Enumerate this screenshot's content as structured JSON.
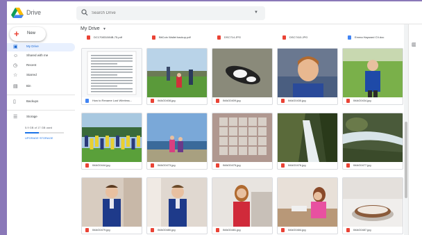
{
  "app": {
    "title": "Drive"
  },
  "search": {
    "placeholder": "Search Drive"
  },
  "new_button": {
    "label": "New"
  },
  "sidebar": {
    "items": [
      {
        "label": "My Drive",
        "icon": "my-drive-icon"
      },
      {
        "label": "Shared with me",
        "icon": "shared-icon"
      },
      {
        "label": "Recent",
        "icon": "clock-icon"
      },
      {
        "label": "Starred",
        "icon": "star-icon"
      },
      {
        "label": "Bin",
        "icon": "trash-icon"
      },
      {
        "label": "Backups",
        "icon": "backup-icon"
      },
      {
        "label": "Storage",
        "icon": "storage-icon"
      }
    ],
    "storage_used": "5.9 GB of 17 GB used",
    "storage_fraction": 0.35,
    "upgrade_label": "UPGRADE STORAGE"
  },
  "main": {
    "breadcrumb": "My Drive",
    "top_row": [
      {
        "name": "DC170831084B-75.pdf",
        "type": "pdf"
      },
      {
        "name": "BitCoin Wallet backup.pdf",
        "type": "pdf"
      },
      {
        "name": "DSC714.JPG",
        "type": "image"
      },
      {
        "name": "DSC7410.JPG",
        "type": "image"
      },
      {
        "name": "Emma Hayward CV.doc",
        "type": "doc"
      }
    ],
    "tiles": [
      {
        "name": "How to Rename Lost Wireless...",
        "type": "doc",
        "thumb": "document"
      },
      {
        "name": "IMAG0408.jpg",
        "type": "image",
        "thumb": "football-field"
      },
      {
        "name": "IMAG0409.jpg",
        "type": "image",
        "thumb": "cow-toy"
      },
      {
        "name": "IMAG0430.jpg",
        "type": "image",
        "thumb": "boy-portrait"
      },
      {
        "name": "IMAG0434.jpg",
        "type": "image",
        "thumb": "boy-blue-shirt"
      },
      {
        "name": "IMAG0444.jpg",
        "type": "image",
        "thumb": "team-photo"
      },
      {
        "name": "IMAG0473.jpg",
        "type": "image",
        "thumb": "girls-beach"
      },
      {
        "name": "IMAG0475.jpg",
        "type": "image",
        "thumb": "wall-tiles"
      },
      {
        "name": "IMAG0476.jpg",
        "type": "image",
        "thumb": "waterfall"
      },
      {
        "name": "IMAG0477.jpg",
        "type": "image",
        "thumb": "stream"
      },
      {
        "name": "IMAG0479.jpg",
        "type": "image",
        "thumb": "boy-uniform"
      },
      {
        "name": "IMAG0480.jpg",
        "type": "image",
        "thumb": "boy-uniform-2"
      },
      {
        "name": "IMAG0481.jpg",
        "type": "image",
        "thumb": "girl-red-top"
      },
      {
        "name": "IMAG0484.jpg",
        "type": "image",
        "thumb": "girl-baking"
      },
      {
        "name": "IMAG0487.jpg",
        "type": "image",
        "thumb": "cake"
      }
    ]
  },
  "colors": {
    "accent": "#1a73e8",
    "pdf": "#ea4335",
    "image": "#ea4335",
    "doc": "#4285f4",
    "active_bg": "#e8f0fe"
  }
}
